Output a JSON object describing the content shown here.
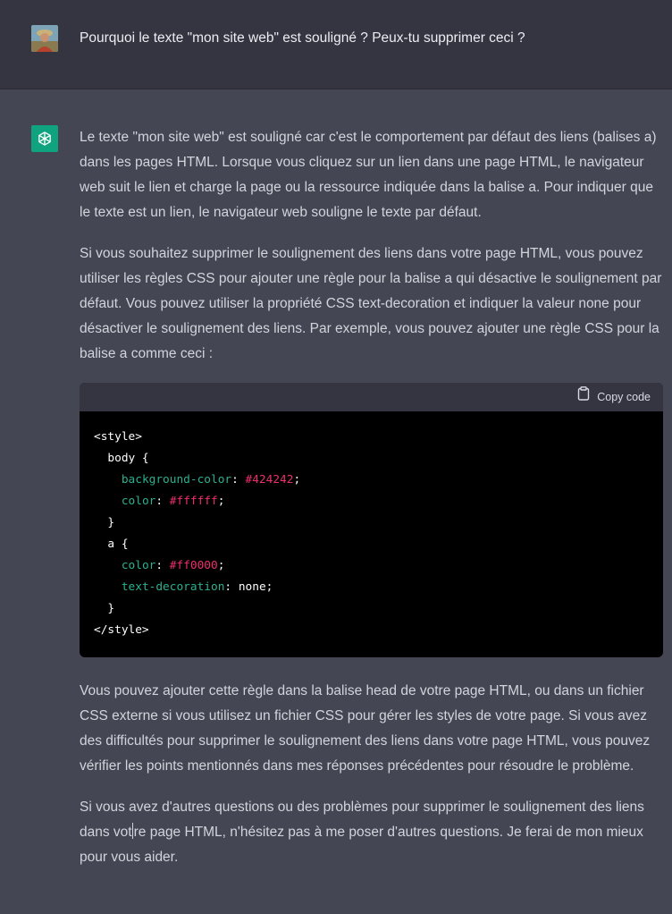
{
  "user": {
    "message": "Pourquoi le texte \"mon site web\" est souligné ? Peux-tu supprimer ceci ?"
  },
  "assistant": {
    "paragraphs": [
      "Le texte \"mon site web\" est souligné car c'est le comportement par défaut des liens (balises a) dans les pages HTML. Lorsque vous cliquez sur un lien dans une page HTML, le navigateur web suit le lien et charge la page ou la ressource indiquée dans la balise a. Pour indiquer que le texte est un lien, le navigateur web souligne le texte par défaut.",
      "Si vous souhaitez supprimer le soulignement des liens dans votre page HTML, vous pouvez utiliser les règles CSS pour ajouter une règle pour la balise a qui désactive le soulignement par défaut. Vous pouvez utiliser la propriété CSS text-decoration et indiquer la valeur none pour désactiver le soulignement des liens. Par exemple, vous pouvez ajouter une règle CSS pour la balise a comme ceci :",
      "Vous pouvez ajouter cette règle dans la balise head de votre page HTML, ou dans un fichier CSS externe si vous utilisez un fichier CSS pour gérer les styles de votre page. Si vous avez des difficultés pour supprimer le soulignement des liens dans votre page HTML, vous pouvez vérifier les points mentionnés dans mes réponses précédentes pour résoudre le problème.",
      "Si vous avez d'autres questions ou des problèmes pour supprimer le soulignement des liens dans votre page HTML, n'hésitez pas à me poser d'autres questions. Je ferai de mon mieux pour vous aider."
    ],
    "last_paragraph_before_caret": "Si vous avez d'autres questions ou des problèmes pour supprimer le soulignement des liens dans vot",
    "last_paragraph_after_caret": "re page HTML, n'hésitez pas à me poser d'autres questions. Je ferai de mon mieux pour vous aider."
  },
  "code": {
    "copy_label": "Copy code",
    "lines": {
      "l1": "<style>",
      "l2": "  body {",
      "l3_prop": "background-color",
      "l3_val": "#424242",
      "l4_prop": "color",
      "l4_val": "#ffffff",
      "l5": "  }",
      "l6": "  a {",
      "l7_prop": "color",
      "l7_val": "#ff0000",
      "l8_prop": "text-decoration",
      "l8_val": "none",
      "l9": "  }",
      "l10": "</style>"
    }
  },
  "colors": {
    "user_bg": "#343541",
    "assistant_bg": "#444654",
    "bot_avatar": "#10a37f",
    "code_property": "#2bb08f",
    "code_hex": "#ee2d70"
  },
  "icons": {
    "user_avatar": "user-photo-avatar",
    "bot_avatar": "openai-logo-icon",
    "copy": "clipboard-icon"
  }
}
